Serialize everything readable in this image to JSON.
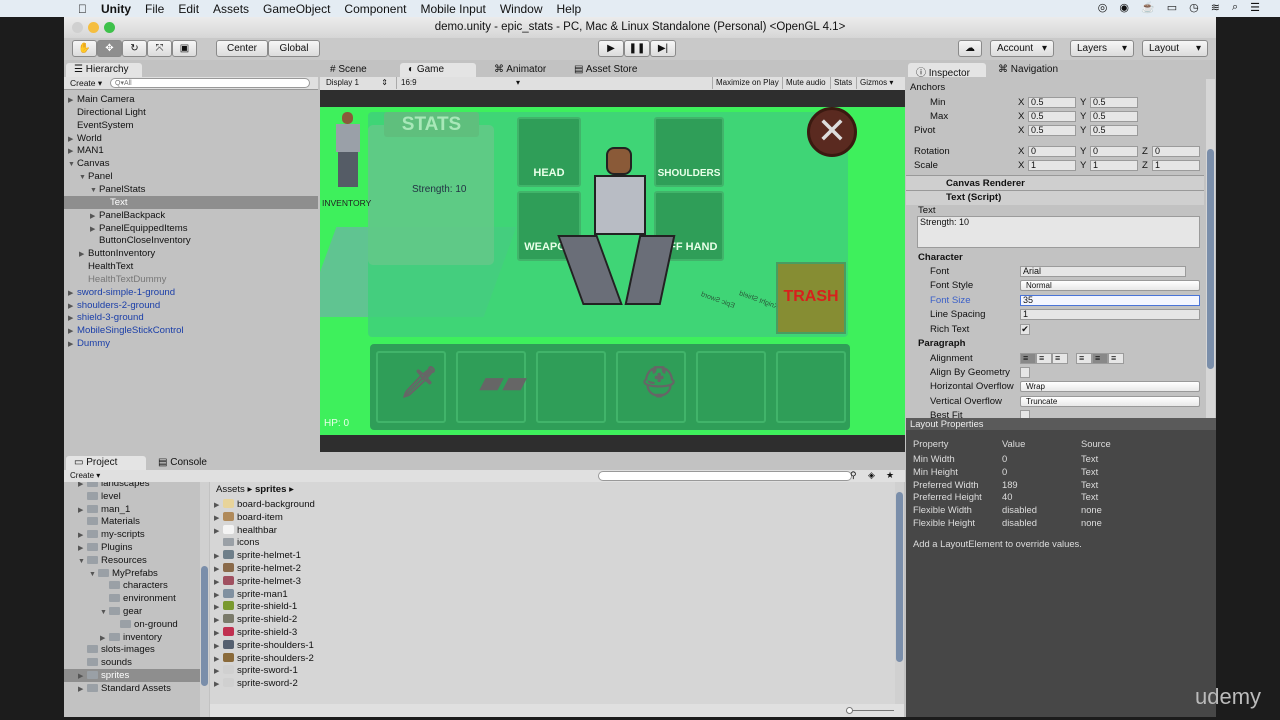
{
  "menubar": {
    "items": [
      "Unity",
      "File",
      "Edit",
      "Assets",
      "GameObject",
      "Component",
      "Mobile Input",
      "Window",
      "Help"
    ]
  },
  "window": {
    "title": "demo.unity - epic_stats - PC, Mac & Linux Standalone (Personal) <OpenGL 4.1>"
  },
  "toolbar": {
    "tools": [
      "hand-icon",
      "move-icon",
      "rotate-icon",
      "scale-icon",
      "rect-icon"
    ],
    "center": "Center",
    "global": "Global",
    "account": "Account",
    "layers": "Layers",
    "layout": "Layout"
  },
  "hierarchy": {
    "tab": "Hierarchy",
    "create": "Create",
    "search_placeholder": "Q▾All",
    "items": [
      {
        "label": "Main Camera",
        "indent": 0,
        "arrow": "right",
        "style": "normal"
      },
      {
        "label": "Directional Light",
        "indent": 0,
        "arrow": "",
        "style": "normal"
      },
      {
        "label": "EventSystem",
        "indent": 0,
        "arrow": "",
        "style": "normal"
      },
      {
        "label": "World",
        "indent": 0,
        "arrow": "right",
        "style": "normal"
      },
      {
        "label": "MAN1",
        "indent": 0,
        "arrow": "right",
        "style": "normal"
      },
      {
        "label": "Canvas",
        "indent": 0,
        "arrow": "down",
        "style": "normal"
      },
      {
        "label": "Panel",
        "indent": 1,
        "arrow": "down",
        "style": "normal"
      },
      {
        "label": "PanelStats",
        "indent": 2,
        "arrow": "down",
        "style": "normal"
      },
      {
        "label": "Text",
        "indent": 3,
        "arrow": "",
        "style": "selected"
      },
      {
        "label": "PanelBackpack",
        "indent": 2,
        "arrow": "right",
        "style": "normal"
      },
      {
        "label": "PanelEquippedItems",
        "indent": 2,
        "arrow": "right",
        "style": "normal"
      },
      {
        "label": "ButtonCloseInventory",
        "indent": 2,
        "arrow": "",
        "style": "normal"
      },
      {
        "label": "ButtonInventory",
        "indent": 1,
        "arrow": "right",
        "style": "normal"
      },
      {
        "label": "HealthText",
        "indent": 1,
        "arrow": "",
        "style": "normal"
      },
      {
        "label": "HealthTextDummy",
        "indent": 1,
        "arrow": "",
        "style": "grey"
      },
      {
        "label": "sword-simple-1-ground",
        "indent": 0,
        "arrow": "right",
        "style": "blue"
      },
      {
        "label": "shoulders-2-ground",
        "indent": 0,
        "arrow": "right",
        "style": "blue"
      },
      {
        "label": "shield-3-ground",
        "indent": 0,
        "arrow": "right",
        "style": "blue"
      },
      {
        "label": "MobileSingleStickControl",
        "indent": 0,
        "arrow": "right",
        "style": "blue"
      },
      {
        "label": "Dummy",
        "indent": 0,
        "arrow": "right",
        "style": "blue"
      }
    ]
  },
  "viewtabs": {
    "scene": "Scene",
    "game": "Game",
    "animator": "Animator",
    "asset_store": "Asset Store"
  },
  "gamebar": {
    "display": "Display 1",
    "aspect": "16:9",
    "maximize": "Maximize on Play",
    "mute": "Mute audio",
    "stats": "Stats",
    "gizmos": "Gizmos"
  },
  "game": {
    "stats_title": "STATS",
    "strength": "Strength: 10",
    "inventory": "INVENTORY",
    "head": "HEAD",
    "shoulders": "SHOULDERS",
    "weapon": "WEAPON",
    "offhand": "OFF HAND",
    "trash": "TRASH",
    "hp": "HP: 0",
    "world_labels": [
      "Epic Sword",
      "Knight Shield"
    ],
    "bg_color": "#3ef05c"
  },
  "inspector": {
    "tab": "Inspector",
    "nav_tab": "Navigation",
    "anchors": "Anchors",
    "min": "Min",
    "max": "Max",
    "pivot": "Pivot",
    "rotation": "Rotation",
    "scale": "Scale",
    "min_x": "0.5",
    "min_y": "0.5",
    "max_x": "0.5",
    "max_y": "0.5",
    "pivot_x": "0.5",
    "pivot_y": "0.5",
    "rot_x": "0",
    "rot_y": "0",
    "rot_z": "0",
    "scale_x": "1",
    "scale_y": "1",
    "scale_z": "1",
    "canvas_renderer": "Canvas Renderer",
    "text_script": "Text (Script)",
    "text_label": "Text",
    "text_value": "Strength: 10",
    "character": "Character",
    "font": "Font",
    "font_value": "Arial",
    "font_style": "Font Style",
    "font_style_value": "Normal",
    "font_size": "Font Size",
    "font_size_value": "35",
    "line_spacing": "Line Spacing",
    "line_spacing_value": "1",
    "rich_text": "Rich Text",
    "rich_text_checked": true,
    "paragraph": "Paragraph",
    "alignment": "Alignment",
    "align_geometry": "Align By Geometry",
    "h_overflow": "Horizontal Overflow",
    "h_overflow_value": "Wrap",
    "v_overflow": "Vertical Overflow",
    "v_overflow_value": "Truncate",
    "best_fit": "Best Fit",
    "axes": [
      "X",
      "Y",
      "Z"
    ]
  },
  "layout_props": {
    "title": "Layout Properties",
    "headers": [
      "Property",
      "Value",
      "Source"
    ],
    "rows": [
      [
        "Min Width",
        "0",
        "Text"
      ],
      [
        "Min Height",
        "0",
        "Text"
      ],
      [
        "Preferred Width",
        "189",
        "Text"
      ],
      [
        "Preferred Height",
        "40",
        "Text"
      ],
      [
        "Flexible Width",
        "disabled",
        "none"
      ],
      [
        "Flexible Height",
        "disabled",
        "none"
      ]
    ],
    "note": "Add a LayoutElement to override values."
  },
  "project": {
    "tab": "Project",
    "console_tab": "Console",
    "create": "Create",
    "breadcrumb": [
      "Assets",
      "sprites"
    ],
    "folders": [
      {
        "label": "landscapes",
        "indent": 0,
        "arrow": "right"
      },
      {
        "label": "level",
        "indent": 0,
        "arrow": ""
      },
      {
        "label": "man_1",
        "indent": 0,
        "arrow": "right"
      },
      {
        "label": "Materials",
        "indent": 0,
        "arrow": ""
      },
      {
        "label": "my-scripts",
        "indent": 0,
        "arrow": "right"
      },
      {
        "label": "Plugins",
        "indent": 0,
        "arrow": "right"
      },
      {
        "label": "Resources",
        "indent": 0,
        "arrow": "down"
      },
      {
        "label": "MyPrefabs",
        "indent": 1,
        "arrow": "down"
      },
      {
        "label": "characters",
        "indent": 2,
        "arrow": ""
      },
      {
        "label": "environment",
        "indent": 2,
        "arrow": ""
      },
      {
        "label": "gear",
        "indent": 2,
        "arrow": "down"
      },
      {
        "label": "on-ground",
        "indent": 3,
        "arrow": ""
      },
      {
        "label": "inventory",
        "indent": 2,
        "arrow": "right"
      },
      {
        "label": "slots-images",
        "indent": 0,
        "arrow": ""
      },
      {
        "label": "sounds",
        "indent": 0,
        "arrow": ""
      },
      {
        "label": "sprites",
        "indent": 0,
        "arrow": "right",
        "selected": true
      },
      {
        "label": "Standard Assets",
        "indent": 0,
        "arrow": "right"
      }
    ],
    "assets": [
      {
        "label": "board-background",
        "color": "#e8d49a"
      },
      {
        "label": "board-item",
        "color": "#b08a5a"
      },
      {
        "label": "healthbar",
        "color": "#f4f4f4"
      },
      {
        "label": "icons",
        "color": "folder"
      },
      {
        "label": "sprite-helmet-1",
        "color": "#6f7f8a"
      },
      {
        "label": "sprite-helmet-2",
        "color": "#8a6a4a"
      },
      {
        "label": "sprite-helmet-3",
        "color": "#a05060"
      },
      {
        "label": "sprite-man1",
        "color": "#8090a0"
      },
      {
        "label": "sprite-shield-1",
        "color": "#7a9a30"
      },
      {
        "label": "sprite-shield-2",
        "color": "#7a7a6a"
      },
      {
        "label": "sprite-shield-3",
        "color": "#c03050"
      },
      {
        "label": "sprite-shoulders-1",
        "color": "#556070"
      },
      {
        "label": "sprite-shoulders-2",
        "color": "#8a6a3a"
      },
      {
        "label": "sprite-sword-1",
        "color": "#d0d0d0"
      },
      {
        "label": "sprite-sword-2",
        "color": "#d0d0d0"
      }
    ]
  },
  "watermark": "udemy"
}
